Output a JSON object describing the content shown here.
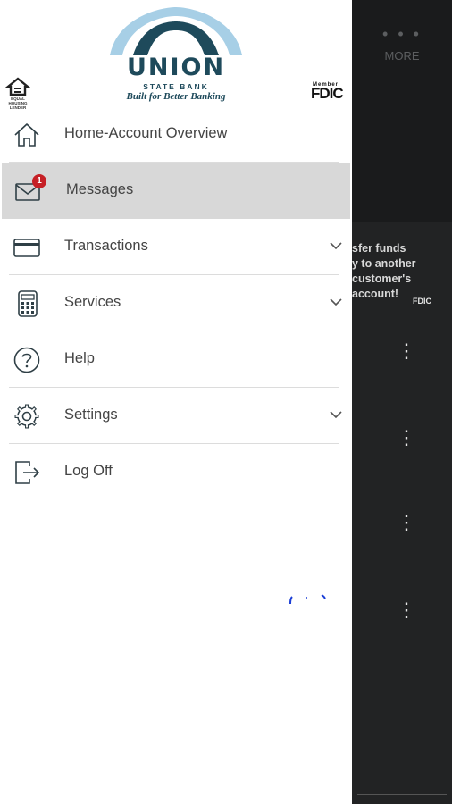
{
  "background": {
    "more_dots": "• • •",
    "more_label": "MORE",
    "promo_text": "sfer funds\ny to another\ncustomer's\naccount!",
    "promo_fdic": "FDIC",
    "kebab_glyph": "⋮"
  },
  "bank": {
    "name": "UNION",
    "subname": "STATE BANK",
    "tagline": "Built for Better Banking",
    "brand_color": "#1e4a5b",
    "arch_colors": [
      "#a7cfe6",
      "#1e4a5b"
    ]
  },
  "equal_housing": {
    "text": "EQUAL HOUSING\nLENDER"
  },
  "fdic": {
    "member": "Member",
    "name": "FDIC"
  },
  "menu": {
    "items": [
      {
        "label": "Home-Account Overview",
        "icon": "home-icon"
      },
      {
        "label": "Messages",
        "icon": "envelope-icon",
        "badge": "1",
        "selected": true
      },
      {
        "label": "Transactions",
        "icon": "card-icon",
        "expandable": true
      },
      {
        "label": "Services",
        "icon": "calculator-icon",
        "expandable": true
      },
      {
        "label": "Help",
        "icon": "help-icon"
      },
      {
        "label": "Settings",
        "icon": "gear-icon",
        "expandable": true
      },
      {
        "label": "Log Off",
        "icon": "logout-icon"
      }
    ]
  },
  "colors": {
    "badge": "#c62026",
    "selected_row": "#d8d8d8",
    "icon": "#2f3f46"
  }
}
